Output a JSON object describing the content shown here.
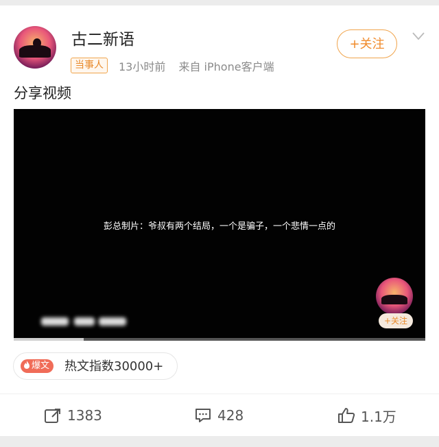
{
  "post": {
    "username": "古二新语",
    "tag": "当事人",
    "time": "13小时前",
    "source": "来自 iPhone客户端",
    "follow_label": "+关注",
    "text": "分享视频"
  },
  "video": {
    "caption": "彭总制片：爷叔有两个结局，一个是骗子，一个悲情一点的",
    "follow_label": "+关注",
    "progress": 0.17
  },
  "hot": {
    "badge": "爆文",
    "label": "热文指数30000+"
  },
  "actions": {
    "repost_count": "1383",
    "comment_count": "428",
    "like_count": "1.1万"
  },
  "icons": [
    "chevron-down-icon",
    "repost-icon",
    "comment-icon",
    "like-icon",
    "fire-icon"
  ],
  "colors": {
    "accent": "#f08a2a",
    "badge": "#f06c58"
  }
}
